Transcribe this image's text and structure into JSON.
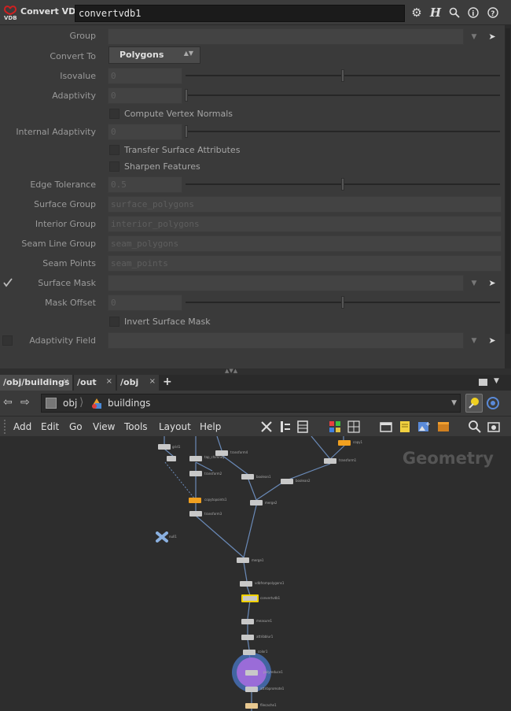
{
  "title_bar": {
    "node_type": "Convert VDB",
    "node_name": "convertvdb1",
    "icons": [
      "gear-icon",
      "help-h-icon",
      "search-icon",
      "info-icon",
      "question-icon"
    ]
  },
  "params": {
    "group": {
      "label": "Group",
      "value": ""
    },
    "convert_to": {
      "label": "Convert To",
      "value": "Polygons"
    },
    "isovalue": {
      "label": "Isovalue",
      "value": "0"
    },
    "adaptivity": {
      "label": "Adaptivity",
      "value": "0"
    },
    "compute_vertex_normals": {
      "label": "Compute Vertex Normals",
      "checked": false
    },
    "internal_adaptivity": {
      "label": "Internal Adaptivity",
      "value": "0"
    },
    "transfer_surface_attributes": {
      "label": "Transfer Surface Attributes",
      "checked": false
    },
    "sharpen_features": {
      "label": "Sharpen Features",
      "checked": false
    },
    "edge_tolerance": {
      "label": "Edge Tolerance",
      "value": "0.5"
    },
    "surface_group": {
      "label": "Surface Group",
      "value": "surface_polygons"
    },
    "interior_group": {
      "label": "Interior Group",
      "value": "interior_polygons"
    },
    "seam_line_group": {
      "label": "Seam Line Group",
      "value": "seam_polygons"
    },
    "seam_points": {
      "label": "Seam Points",
      "value": "seam_points"
    },
    "surface_mask": {
      "label": "Surface Mask",
      "value": "",
      "enabled": true
    },
    "mask_offset": {
      "label": "Mask Offset",
      "value": "0"
    },
    "invert_surface_mask": {
      "label": "Invert Surface Mask",
      "checked": false
    },
    "adaptivity_field": {
      "label": "Adaptivity Field",
      "value": "",
      "enabled": false
    }
  },
  "tabs": [
    {
      "label": "/obj/buildings",
      "active": true
    },
    {
      "label": "/out",
      "active": false
    },
    {
      "label": "/obj",
      "active": false
    }
  ],
  "add_tab_label": "+",
  "path": {
    "root": "obj",
    "current": "buildings"
  },
  "menu": [
    "Add",
    "Edit",
    "Go",
    "View",
    "Tools",
    "Layout",
    "Help"
  ],
  "network": {
    "context_label": "Geometry",
    "nodes": [
      {
        "id": "grid1",
        "label": "grid1"
      },
      {
        "id": "tap_chimney",
        "label": "tap_chimney"
      },
      {
        "id": "transform4",
        "label": "transform4"
      },
      {
        "id": "copy1",
        "label": "copy1"
      },
      {
        "id": "transform2",
        "label": "transform2"
      },
      {
        "id": "boolean1",
        "label": "boolean1"
      },
      {
        "id": "boolean2",
        "label": "boolean2"
      },
      {
        "id": "transform1",
        "label": "transform1"
      },
      {
        "id": "copytopoints1",
        "label": "copytopoints1"
      },
      {
        "id": "merge2",
        "label": "merge2"
      },
      {
        "id": "transform3",
        "label": "transform3"
      },
      {
        "id": "null1",
        "label": "null1"
      },
      {
        "id": "merge1",
        "label": "merge1"
      },
      {
        "id": "vdbfrompolygons1",
        "label": "vdbfrompolygons1"
      },
      {
        "id": "convertvdb1",
        "label": "convertvdb1"
      },
      {
        "id": "measure1",
        "label": "measure1"
      },
      {
        "id": "attribblur1",
        "label": "attribblur1"
      },
      {
        "id": "color1",
        "label": "color1"
      },
      {
        "id": "polyreduce1",
        "label": "polyreduce1"
      },
      {
        "id": "attribpromote1",
        "label": "attribpromote1"
      },
      {
        "id": "filecache1",
        "label": "filecache1"
      }
    ]
  },
  "colors": {
    "selected_node_outline": "#f0d000",
    "orange_node": "#f0a020",
    "purple_node": "#9a6cd8",
    "blue_ring": "#4a78c8"
  }
}
